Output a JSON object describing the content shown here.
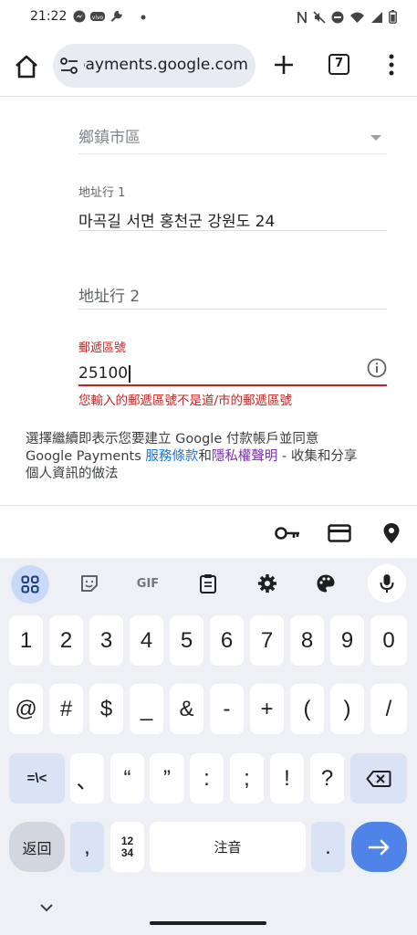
{
  "status": {
    "time": "21:22",
    "icons": [
      "messenger-icon",
      "vivo-icon",
      "wrench-icon",
      "dot-icon",
      "nfc-icon",
      "mute-icon",
      "dnd-icon",
      "wifi-icon",
      "signal-icon",
      "battery-icon"
    ]
  },
  "toolbar": {
    "url": "payments.google.com",
    "tab_count": "7"
  },
  "form": {
    "district_label": "鄉鎮市區",
    "address1_label": "地址行 1",
    "address1_value": "마곡길 서면 홍천군 강원도 24",
    "address2_label": "地址行 2",
    "postal_label": "郵遞區號",
    "postal_value": "25100",
    "postal_error": "您輸入的郵遞區號不是道/市的郵遞區號"
  },
  "disclaimer": {
    "line1": "選擇繼續即表示您要建立 Google 付款帳戶並同意",
    "prefix2": "Google Payments ",
    "terms_link": "服務條款",
    "and": "和",
    "privacy_link": "隱私權聲明",
    "suffix2": " - 收集和分享",
    "line3": "個人資訊的做法"
  },
  "keyboard": {
    "row1": [
      "1",
      "2",
      "3",
      "4",
      "5",
      "6",
      "7",
      "8",
      "9",
      "0"
    ],
    "row2": [
      "@",
      "#",
      "$",
      "_",
      "&",
      "-",
      "+",
      "(",
      ")",
      "/"
    ],
    "row3": [
      "=\\<",
      "、",
      "“",
      "”",
      ":",
      ";",
      "!",
      "?"
    ],
    "back_label": "返回",
    "comma": ",",
    "numpad_label": "12\n34",
    "space_label": "注音",
    "period": ".",
    "gif_label": "GIF"
  },
  "colors": {
    "error": "#c5221f",
    "link_blue": "#1a73e8",
    "link_purple": "#7b2bb5",
    "enter_key": "#4f83e8"
  }
}
